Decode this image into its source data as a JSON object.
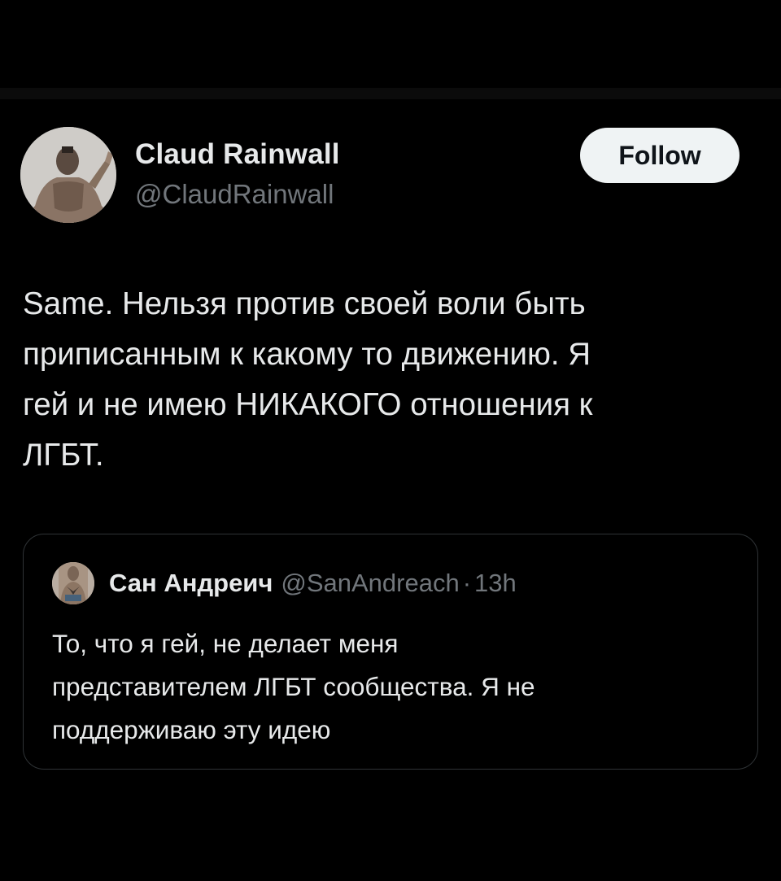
{
  "tweet": {
    "author": {
      "name": "Claud Rainwall",
      "handle": "@ClaudRainwall",
      "avatar_icon": "profile-photo"
    },
    "follow_label": "Follow",
    "text": "Same. Нельзя против своей воли быть\nприписанным к какому то движению. Я\nгей и не имею НИКАКОГО отношения к\nЛГБТ."
  },
  "quoted_tweet": {
    "author": {
      "name": "Сан Андреич",
      "handle": "@SanAndreach",
      "avatar_icon": "profile-photo"
    },
    "separator": "·",
    "time": "13h",
    "text": "То, что я гей, не делает меня\nпредставителем ЛГБТ сообщества.  Я не\nподдерживаю эту идею"
  },
  "colors": {
    "background": "#000000",
    "primary_text": "#e7e9ea",
    "secondary_text": "#71767b",
    "border": "#2f3336",
    "follow_button_bg": "#eff3f4",
    "follow_button_text": "#0f1419"
  }
}
